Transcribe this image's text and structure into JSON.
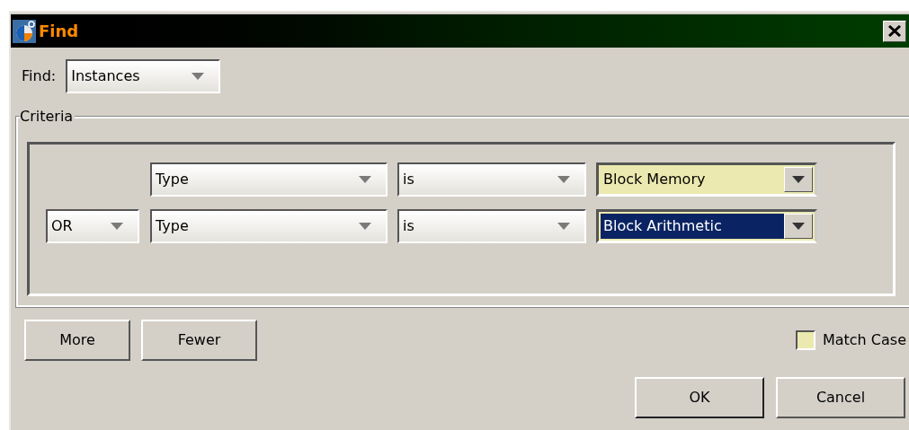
{
  "window": {
    "title": "Find"
  },
  "find": {
    "label": "Find:",
    "value": "Instances"
  },
  "criteria": {
    "legend": "Criteria",
    "rows": [
      {
        "connector": null,
        "field": "Type",
        "operator": "is",
        "value": "Block Memory",
        "selected": false
      },
      {
        "connector": "OR",
        "field": "Type",
        "operator": "is",
        "value": "Block Arithmetic",
        "selected": true
      }
    ]
  },
  "buttons": [
    "More",
    "Fewer"
  ],
  "match_case": {
    "label": "Match Case",
    "checked": false
  },
  "dialog_buttons": [
    {
      "label": "OK",
      "default": true
    },
    {
      "label": "Cancel",
      "default": false
    }
  ]
}
